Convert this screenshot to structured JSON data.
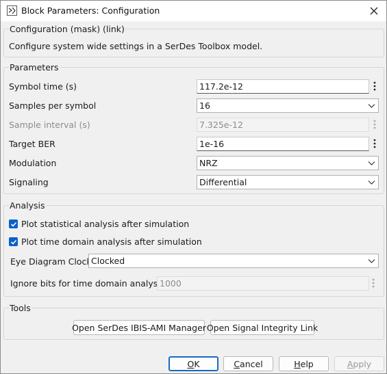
{
  "window": {
    "title": "Block Parameters: Configuration"
  },
  "header": {
    "title": "Configuration (mask) (link)",
    "description": "Configure system wide settings in a SerDes Toolbox model."
  },
  "parameters": {
    "group_title": "Parameters",
    "symbol_time": {
      "label": "Symbol time (s)",
      "value": "117.2e-12"
    },
    "samples_per_symbol": {
      "label": "Samples per symbol",
      "value": "16"
    },
    "sample_interval": {
      "label": "Sample interval (s)",
      "value": "7.325e-12"
    },
    "target_ber": {
      "label": "Target BER",
      "value": "1e-16"
    },
    "modulation": {
      "label": "Modulation",
      "value": "NRZ"
    },
    "signaling": {
      "label": "Signaling",
      "value": "Differential"
    }
  },
  "analysis": {
    "group_title": "Analysis",
    "plot_statistical": {
      "label": "Plot statistical analysis after simulation",
      "checked": true
    },
    "plot_time_domain": {
      "label": "Plot time domain analysis after simulation",
      "checked": true
    },
    "eye_diagram_clock": {
      "label": "Eye Diagram Clock",
      "value": "Clocked"
    },
    "ignore_bits": {
      "label": "Ignore bits for time domain analysis",
      "value": "1000"
    }
  },
  "tools": {
    "group_title": "Tools",
    "ibis_ami_button": "Open SerDes IBIS-AMI Manager",
    "signal_integrity_button": "Open Signal Integrity Link"
  },
  "footer": {
    "ok": {
      "mnemonic": "O",
      "rest": "K"
    },
    "cancel": {
      "mnemonic": "C",
      "rest": "ancel"
    },
    "help": {
      "mnemonic": "H",
      "rest": "elp"
    },
    "apply": {
      "mnemonic": "A",
      "rest": "pply"
    }
  },
  "colors": {
    "accent": "#0a62c7",
    "default_button_border": "#1769c4"
  }
}
